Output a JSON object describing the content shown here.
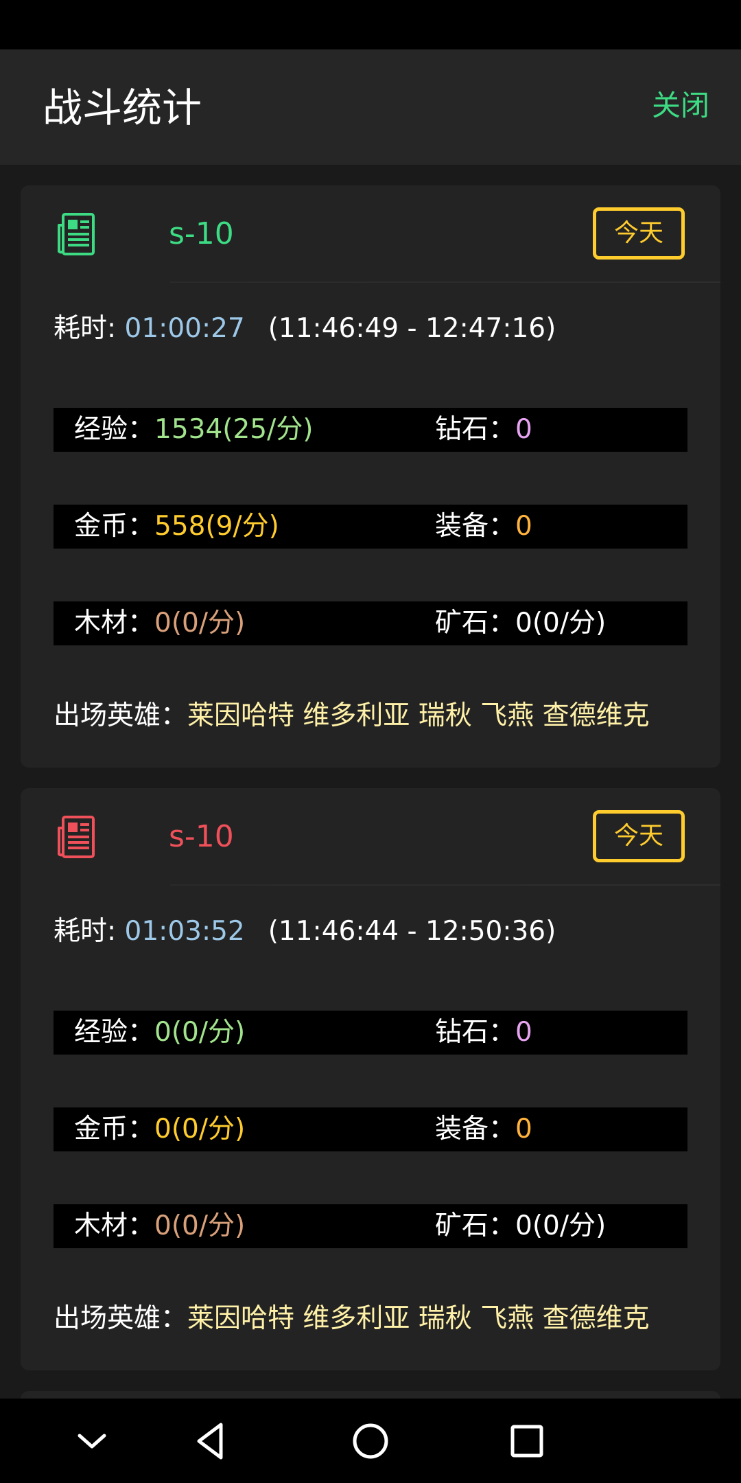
{
  "header": {
    "title": "战斗统计",
    "close_label": "关闭"
  },
  "cards": [
    {
      "id": "s-10",
      "icon": "newspaper-icon",
      "icon_color": "#3ddc84",
      "today_label": "今天",
      "duration_label": "耗时: ",
      "duration_value": "01:00:27",
      "time_range": "(11:46:49 - 12:47:16)",
      "exp_label": "经验：",
      "exp_value": "1534(25/分)",
      "diamond_label": "钻石：",
      "diamond_value": "0",
      "gold_label": "金币：",
      "gold_value": "558(9/分)",
      "equip_label": "装备：",
      "equip_value": "0",
      "wood_label": "木材：",
      "wood_value": "0(0/分)",
      "ore_label": "矿石：",
      "ore_value": "0(0/分)",
      "heroes_label": "出场英雄：",
      "heroes_value": "莱因哈特 维多利亚 瑞秋 飞燕 查德维克"
    },
    {
      "id": "s-10",
      "icon": "newspaper-icon",
      "icon_color": "#f0505a",
      "today_label": "今天",
      "duration_label": "耗时: ",
      "duration_value": "01:03:52",
      "time_range": "(11:46:44 - 12:50:36)",
      "exp_label": "经验：",
      "exp_value": "0(0/分)",
      "diamond_label": "钻石：",
      "diamond_value": "0",
      "gold_label": "金币：",
      "gold_value": "0(0/分)",
      "equip_label": "装备：",
      "equip_value": "0",
      "wood_label": "木材：",
      "wood_value": "0(0/分)",
      "ore_label": "矿石：",
      "ore_value": "0(0/分)",
      "heroes_label": "出场英雄：",
      "heroes_value": "莱因哈特 维多利亚 瑞秋 飞燕 查德维克"
    }
  ],
  "nav": {
    "icons": [
      "chevron-down-icon",
      "back-icon",
      "home-icon",
      "recents-icon"
    ]
  }
}
